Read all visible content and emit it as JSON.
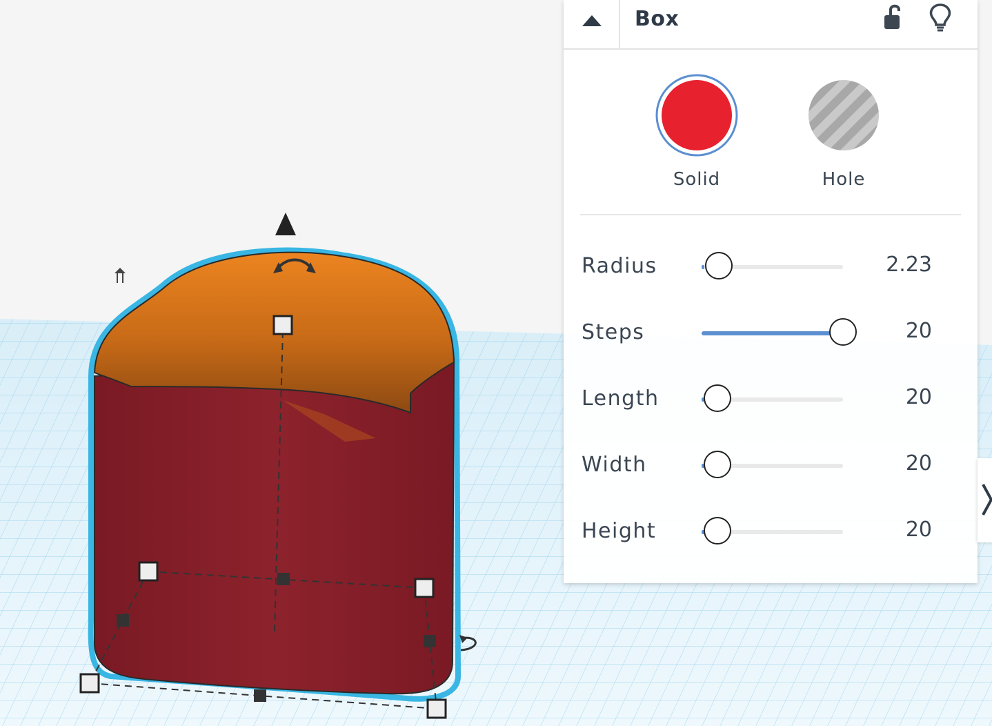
{
  "inspector": {
    "title": "Box",
    "collapse_icon": "caret-up-icon",
    "lock_icon": "unlocked-padlock-icon",
    "hint_icon": "lightbulb-icon",
    "materials": {
      "solid": {
        "label": "Solid",
        "color": "#e8212e",
        "selected": true
      },
      "hole": {
        "label": "Hole",
        "selected": false
      }
    },
    "properties": [
      {
        "label": "Radius",
        "value": "2.23",
        "slider_fraction": 0.12
      },
      {
        "label": "Steps",
        "value": "20",
        "slider_fraction": 1.0
      },
      {
        "label": "Length",
        "value": "20",
        "slider_fraction": 0.11
      },
      {
        "label": "Width",
        "value": "20",
        "slider_fraction": 0.11
      },
      {
        "label": "Height",
        "value": "20",
        "slider_fraction": 0.11
      }
    ]
  },
  "scene": {
    "shape_top_color": "#e8801e",
    "shape_body_color": "#8a1f2a",
    "selection_outline_color": "#39b6e3",
    "grid_color": "#7cc7ea"
  },
  "colors": {
    "accent": "#5b8fd0",
    "text": "#3b4652"
  }
}
